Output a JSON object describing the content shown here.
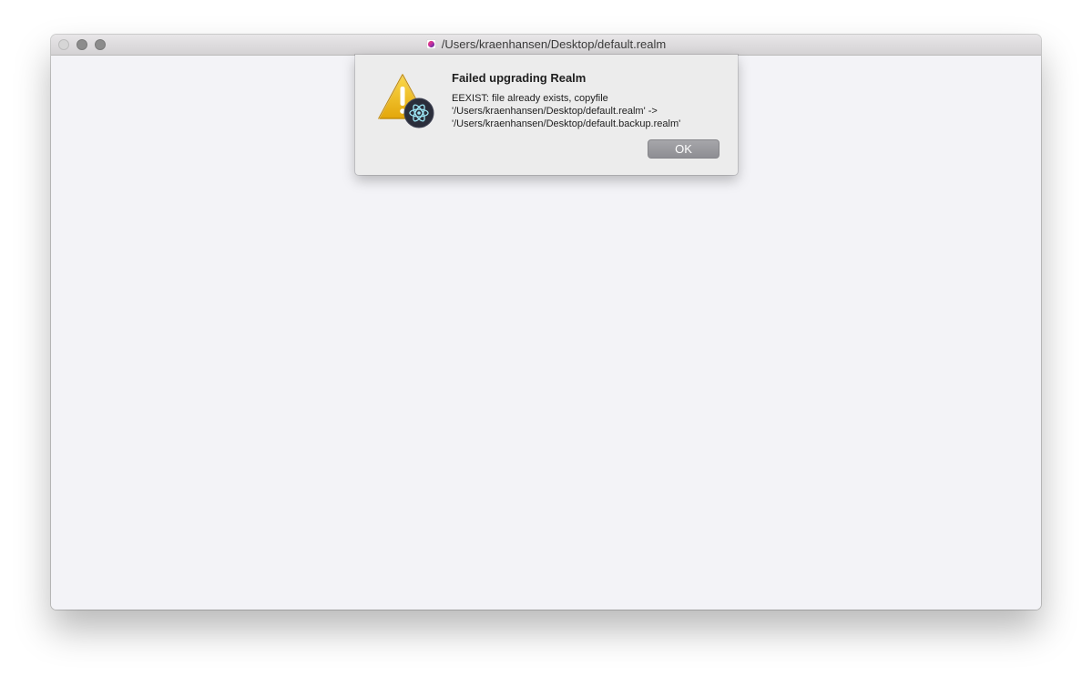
{
  "window": {
    "title": "/Users/kraenhansen/Desktop/default.realm",
    "title_icon": "realm-app-icon"
  },
  "dialog": {
    "icon": "warning-icon",
    "badge_icon": "electron-app-icon",
    "title": "Failed upgrading Realm",
    "message": "EEXIST: file already exists, copyfile '/Users/kraenhansen/Desktop/default.realm' -> '/Users/kraenhansen/Desktop/default.backup.realm'",
    "ok_label": "OK"
  },
  "colors": {
    "content_background": "#f3f3f7",
    "dialog_background": "#ececec",
    "warning_yellow": "#f2c01e",
    "button_gray": "#8e8e93"
  }
}
